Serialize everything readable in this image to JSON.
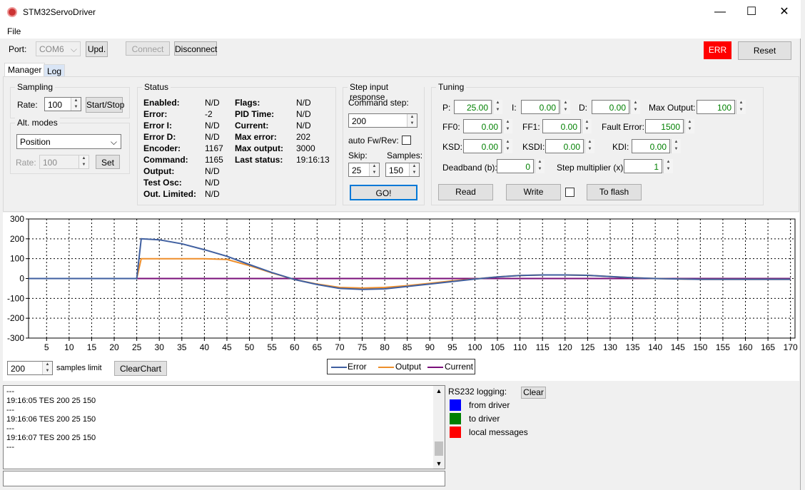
{
  "window": {
    "title": "STM32ServoDriver",
    "minimize": "—",
    "maximize": "☐",
    "close": "✕"
  },
  "menu": {
    "file": "File"
  },
  "toolbar": {
    "port_label": "Port:",
    "port_value": "COM6",
    "update": "Upd.",
    "connect": "Connect",
    "disconnect": "Disconnect",
    "err": "ERR",
    "reset": "Reset"
  },
  "tabs": [
    "Manager",
    "Log"
  ],
  "sampling": {
    "title": "Sampling",
    "rate_label": "Rate:",
    "rate_value": "100",
    "start_stop": "Start/Stop"
  },
  "alt_modes": {
    "title": "Alt. modes",
    "mode": "Position",
    "rate_label": "Rate:",
    "rate_value": "100",
    "set": "Set"
  },
  "status": {
    "title": "Status",
    "left": [
      {
        "label": "Enabled:",
        "value": "N/D"
      },
      {
        "label": "Error:",
        "value": "-2"
      },
      {
        "label": "Error I:",
        "value": "N/D"
      },
      {
        "label": "Error D:",
        "value": "N/D"
      },
      {
        "label": "Encoder:",
        "value": "1167"
      },
      {
        "label": "Command:",
        "value": "1165"
      },
      {
        "label": "Output:",
        "value": "N/D"
      },
      {
        "label": "Test Osc:",
        "value": "N/D"
      },
      {
        "label": "Out. Limited:",
        "value": "N/D"
      }
    ],
    "right": [
      {
        "label": "Flags:",
        "value": "N/D"
      },
      {
        "label": "PID Time:",
        "value": "N/D"
      },
      {
        "label": "Current:",
        "value": "N/D"
      },
      {
        "label": "Max error:",
        "value": "202"
      },
      {
        "label": "Max output:",
        "value": "3000"
      },
      {
        "label": "Last status:",
        "value": "19:16:13"
      }
    ]
  },
  "step": {
    "title": "Step input response",
    "command_label": "Command step:",
    "command_value": "200",
    "auto_label": "auto Fw/Rev:",
    "skip_label": "Skip:",
    "skip_value": "25",
    "samples_label": "Samples:",
    "samples_value": "150",
    "go": "GO!"
  },
  "tuning": {
    "title": "Tuning",
    "p_label": "P:",
    "p": "25.00",
    "i_label": "I:",
    "i": "0.00",
    "d_label": "D:",
    "d": "0.00",
    "max_out_label": "Max Output:",
    "max_out": "100",
    "ff0_label": "FF0:",
    "ff0": "0.00",
    "ff1_label": "FF1:",
    "ff1": "0.00",
    "fault_label": "Fault Error:",
    "fault": "1500",
    "ksd_label": "KSD:",
    "ksd": "0.00",
    "ksdi_label": "KSDI:",
    "ksdi": "0.00",
    "kdi_label": "KDI:",
    "kdi": "0.00",
    "deadband_label": "Deadband (b):",
    "deadband": "0",
    "step_mult_label": "Step multiplier (x):",
    "step_mult": "1",
    "read": "Read",
    "write": "Write",
    "to_flash": "To flash"
  },
  "chart_controls": {
    "samples_value": "200",
    "samples_label": "samples limit",
    "clear": "ClearChart"
  },
  "chart_data": {
    "type": "line",
    "xlim": [
      1,
      171
    ],
    "ylim": [
      -300,
      300
    ],
    "x_ticks": [
      5,
      10,
      15,
      20,
      25,
      30,
      35,
      40,
      45,
      50,
      55,
      60,
      65,
      70,
      75,
      80,
      85,
      90,
      95,
      100,
      105,
      110,
      115,
      120,
      125,
      130,
      135,
      140,
      145,
      150,
      155,
      160,
      165,
      170
    ],
    "y_ticks": [
      300,
      200,
      100,
      0,
      -100,
      -200,
      -300
    ],
    "grid": true,
    "legend": "bottom-center",
    "series": [
      {
        "name": "Error",
        "color": "#3f5fa0",
        "x": [
          1,
          25,
          26,
          30,
          35,
          40,
          45,
          50,
          55,
          60,
          65,
          70,
          75,
          80,
          85,
          90,
          95,
          100,
          105,
          110,
          115,
          120,
          125,
          130,
          135,
          140,
          145,
          150,
          155,
          160,
          165,
          170
        ],
        "y": [
          0,
          0,
          200,
          195,
          175,
          145,
          112,
          70,
          30,
          -5,
          -30,
          -50,
          -55,
          -52,
          -40,
          -28,
          -15,
          -3,
          8,
          15,
          18,
          18,
          16,
          10,
          4,
          0,
          -2,
          -4,
          -4,
          -4,
          -4,
          -4
        ]
      },
      {
        "name": "Output",
        "color": "#ee8e2a",
        "x": [
          1,
          25,
          26,
          30,
          35,
          40,
          45,
          50,
          55,
          60,
          65,
          70,
          75,
          80,
          85,
          90,
          95,
          100,
          105,
          110,
          115,
          120,
          125,
          130,
          135,
          140,
          145,
          150,
          155,
          160,
          165,
          170
        ],
        "y": [
          0,
          0,
          100,
          100,
          100,
          100,
          96,
          65,
          28,
          -5,
          -28,
          -45,
          -48,
          -45,
          -36,
          -24,
          -12,
          -2,
          8,
          15,
          18,
          18,
          16,
          10,
          4,
          0,
          -2,
          -4,
          -4,
          -4,
          -4,
          -4
        ]
      },
      {
        "name": "Current",
        "color": "#7a0f7a",
        "x": [
          1,
          170
        ],
        "y": [
          0,
          0
        ]
      }
    ]
  },
  "log": {
    "lines": [
      "---",
      "19:16:05  TES 200 25 150",
      "---",
      "19:16:06  TES 200 25 150",
      "---",
      "19:16:07  TES 200 25 150",
      "---"
    ]
  },
  "rs232": {
    "label": "RS232 logging:",
    "clear": "Clear",
    "items": [
      {
        "label": "from driver",
        "color": "#0000ff"
      },
      {
        "label": "to driver",
        "color": "#008000"
      },
      {
        "label": "local messages",
        "color": "#ff0000"
      }
    ]
  }
}
